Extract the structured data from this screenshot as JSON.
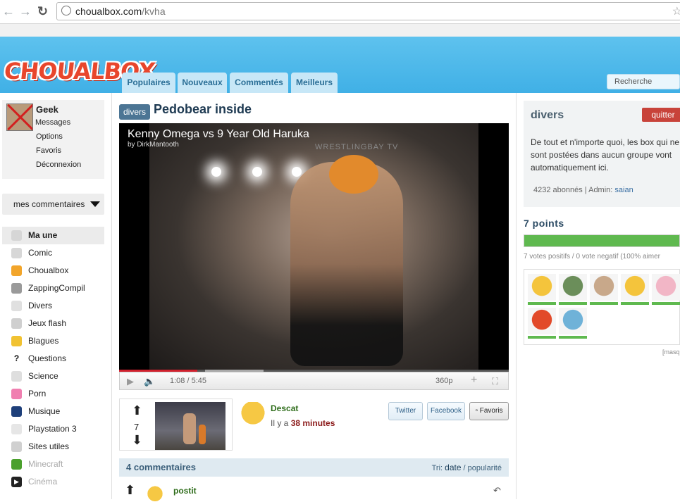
{
  "browser": {
    "url_domain": "choualbox.com",
    "url_path": "/kvha"
  },
  "site": {
    "logo": "CHOUALBOX",
    "tabs": [
      "Populaires",
      "Nouveaux",
      "Commentés",
      "Meilleurs"
    ],
    "search_placeholder": "Recherche"
  },
  "user": {
    "name": "Geek",
    "links": [
      "Messages",
      "Options",
      "Favoris",
      "Déconnexion"
    ]
  },
  "sidebar": {
    "comments_dropdown": "mes commentaires",
    "categories": [
      {
        "label": "Ma une",
        "icon": "funnel-icon",
        "color": "#d6d6d6",
        "active": true
      },
      {
        "label": "Comic",
        "icon": "rage-face-icon",
        "color": "#d7d7d7"
      },
      {
        "label": "Choualbox",
        "icon": "duck-icon",
        "color": "#f2a52b"
      },
      {
        "label": "ZappingCompil",
        "icon": "grid-icon",
        "color": "#9a9a9a"
      },
      {
        "label": "Divers",
        "icon": "blank-icon",
        "color": "#e0e0e0"
      },
      {
        "label": "Jeux flash",
        "icon": "gamepad-icon",
        "color": "#cfcfcf"
      },
      {
        "label": "Blagues",
        "icon": "laugh-face-icon",
        "color": "#f1c232"
      },
      {
        "label": "Questions",
        "icon": "question-icon",
        "color": "#ffffff"
      },
      {
        "label": "Science",
        "icon": "atom-icon",
        "color": "#dedede"
      },
      {
        "label": "Porn",
        "icon": "pink-square-icon",
        "color": "#f07fb0"
      },
      {
        "label": "Musique",
        "icon": "music-globe-icon",
        "color": "#1e3f7a"
      },
      {
        "label": "Playstation 3",
        "icon": "playstation-icon",
        "color": "#e6e6e6"
      },
      {
        "label": "Sites utiles",
        "icon": "wrench-icon",
        "color": "#d0d0d0"
      },
      {
        "label": "Minecraft",
        "icon": "creeper-icon",
        "color": "#4aa02c",
        "dim": true
      },
      {
        "label": "Cinéma",
        "icon": "play-icon",
        "color": "#222222",
        "dim": true
      }
    ]
  },
  "post": {
    "category_badge": "divers",
    "title": "Pedobear inside",
    "video": {
      "title": "Kenny Omega vs 9 Year Old Haruka",
      "by": "by DirkMantooth",
      "watermark": "WRESTLINGBAY TV",
      "time": "1:08 / 5:45",
      "quality": "360p",
      "progress": 0.2
    },
    "votes": "7",
    "author": "Descat",
    "time_prefix": "Il y a",
    "time_value": "38 minutes",
    "share": {
      "twitter": "Twitter",
      "facebook": "Facebook",
      "favoris": "Favoris"
    }
  },
  "comments": {
    "count_label": "4 commentaires",
    "sort_prefix": "Tri:",
    "sort_date": "date",
    "sort_sep": " / ",
    "sort_popularity": "popularité",
    "first_author": "postit"
  },
  "group": {
    "name": "divers",
    "quit": "quitter",
    "description": "De tout et n'importe quoi, les box qui ne sont postées dans aucun groupe vont automatiquement ici.",
    "subscribers": "4232 abonnés",
    "admin_label": "| Admin:",
    "admin_name": "saian"
  },
  "points": {
    "label": "7 points",
    "fill_fraction": 1.0,
    "votes_text": "7 votes positifs / 0 vote negatif (100% aimer"
  },
  "voters": [
    {
      "icon": "duck-avatar-icon",
      "color": "#f4c43c"
    },
    {
      "icon": "tree-avatar-icon",
      "color": "#6b8e5a"
    },
    {
      "icon": "child-photo-avatar-icon",
      "color": "#c8a88a"
    },
    {
      "icon": "duck-avatar-icon",
      "color": "#f4c43c"
    },
    {
      "icon": "anime-avatar-icon",
      "color": "#f2b6c6"
    },
    {
      "icon": "bird-cartoon-avatar-icon",
      "color": "#e24a2a"
    },
    {
      "icon": "blue-cat-avatar-icon",
      "color": "#6fb2d8"
    }
  ],
  "masq_label": "[masq"
}
